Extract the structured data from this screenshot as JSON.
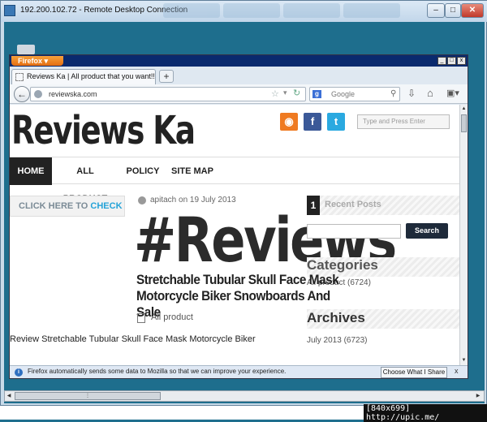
{
  "rdp": {
    "title": "192.200.102.72 - Remote Desktop Connection",
    "min_label": "–",
    "max_label": "□",
    "close_label": "✕"
  },
  "firefox": {
    "menu_button": "Firefox ▾",
    "tab_title": "Reviews Ka | All product that you want!!",
    "new_tab": "+",
    "url": "reviewska.com",
    "search_placeholder": "Google",
    "search_engine_letter": "g",
    "win_min": "_",
    "win_max": "□",
    "win_close": "x"
  },
  "site": {
    "logo": "Reviews Ka",
    "search_placeholder": "Type and Press Enter",
    "social": {
      "rss": "◉",
      "facebook": "f",
      "twitter": "t"
    },
    "nav": [
      "HOME",
      "ALL PRODUCT",
      "POLICY",
      "SITE MAP"
    ],
    "banner_gray": "CLICK HERE TO ",
    "banner_blue": "CHECK P",
    "post": {
      "meta": "apitach on 19 July 2013",
      "big_heading": "#Reviews",
      "title": "Stretchable Tubular Skull Face Mask Motorcycle Biker Snowboards And Sale",
      "category": "All product",
      "excerpt": "Review Stretchable Tubular Skull Face Mask Motorcycle Biker"
    },
    "sidebar": {
      "recent_num": "1",
      "recent_title": "Recent Posts",
      "search_button": "Search",
      "categories_heading": "Categories",
      "categories_item": "All product (6724)",
      "archives_heading": "Archives",
      "archives_item": "July 2013 (6723)"
    }
  },
  "notification": {
    "text": "Firefox automatically sends some data to Mozilla so that we can improve your experience.",
    "button": "Choose What I Share",
    "close": "x",
    "icon": "i"
  },
  "watermark": "[840x699] http://upic.me/"
}
